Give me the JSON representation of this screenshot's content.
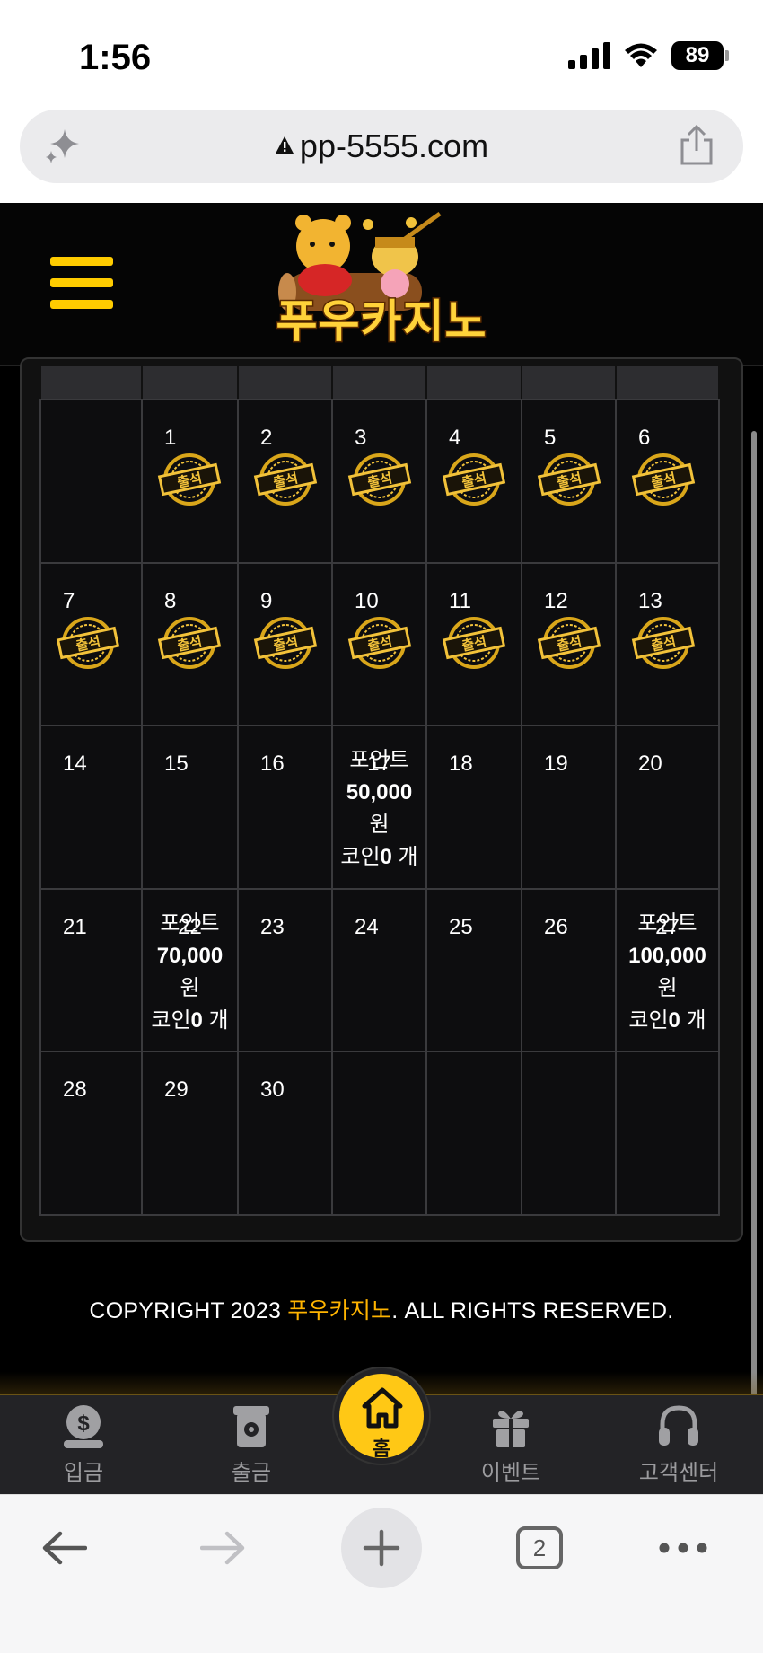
{
  "status_bar": {
    "time": "1:56",
    "battery": "89"
  },
  "browser": {
    "url": "pp-5555.com",
    "tab_count": "2"
  },
  "site": {
    "logo_text": "푸우카지노"
  },
  "calendar": {
    "weeks": [
      [
        {
          "day": ""
        },
        {
          "day": "1",
          "stamp": true
        },
        {
          "day": "2",
          "stamp": true
        },
        {
          "day": "3",
          "stamp": true
        },
        {
          "day": "4",
          "stamp": true
        },
        {
          "day": "5",
          "stamp": true
        },
        {
          "day": "6",
          "stamp": true
        }
      ],
      [
        {
          "day": "7",
          "stamp": true
        },
        {
          "day": "8",
          "stamp": true
        },
        {
          "day": "9",
          "stamp": true
        },
        {
          "day": "10",
          "stamp": true
        },
        {
          "day": "11",
          "stamp": true
        },
        {
          "day": "12",
          "stamp": true
        },
        {
          "day": "13",
          "stamp": true
        }
      ],
      [
        {
          "day": "14"
        },
        {
          "day": "15"
        },
        {
          "day": "16"
        },
        {
          "day": "17",
          "reward": {
            "line1": "포인트",
            "amount": "50,000",
            "unit": "원",
            "coin_label": "코인",
            "coin_value": "0",
            "coin_unit": " 개"
          }
        },
        {
          "day": "18"
        },
        {
          "day": "19"
        },
        {
          "day": "20"
        }
      ],
      [
        {
          "day": "21"
        },
        {
          "day": "22",
          "reward": {
            "line1": "포인트",
            "amount": "70,000",
            "unit": "원",
            "coin_label": "코인",
            "coin_value": "0",
            "coin_unit": " 개"
          }
        },
        {
          "day": "23"
        },
        {
          "day": "24"
        },
        {
          "day": "25"
        },
        {
          "day": "26"
        },
        {
          "day": "27",
          "reward": {
            "line1": "포인트",
            "amount": "100,000",
            "unit": "원",
            "coin_label": "코인",
            "coin_value": "0",
            "coin_unit": " 개"
          }
        }
      ],
      [
        {
          "day": "28"
        },
        {
          "day": "29"
        },
        {
          "day": "30"
        },
        {
          "day": ""
        },
        {
          "day": ""
        },
        {
          "day": ""
        },
        {
          "day": ""
        }
      ]
    ],
    "stamp_label": "출석"
  },
  "footer": {
    "copyright_prefix": "COPYRIGHT 2023 ",
    "copyright_brand": "푸우카지노",
    "copyright_suffix": ". ALL RIGHTS RESERVED."
  },
  "bottom_nav": {
    "deposit": "입금",
    "withdraw": "출금",
    "home": "홈",
    "event": "이벤트",
    "support": "고객센터"
  },
  "colors": {
    "accent": "#ffc815",
    "brand_text": "#ffb400",
    "background": "#000000"
  }
}
